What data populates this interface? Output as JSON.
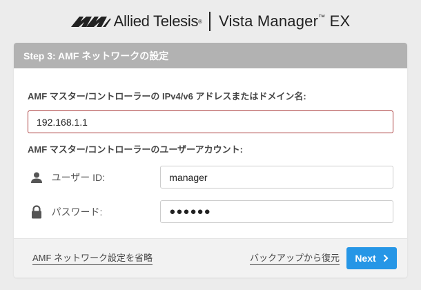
{
  "brand": {
    "company": "Allied Telesis",
    "registered_mark": "®",
    "product": "Vista Manager",
    "trademark": "™",
    "product_suffix": "EX"
  },
  "header": {
    "title": "Step 3: AMF ネットワークの設定"
  },
  "form": {
    "address_label": "AMF マスター/コントローラーの IPv4/v6 アドレスまたはドメイン名:",
    "address_value": "192.168.1.1",
    "account_label": "AMF マスター/コントローラーのユーザーアカウント:",
    "user_label": "ユーザー ID:",
    "user_value": "manager",
    "user_icon": "person-icon",
    "password_label": "パスワード:",
    "password_value": "●●●●●●",
    "password_icon": "lock-icon"
  },
  "footer": {
    "skip_label": "AMF ネットワーク設定を省略",
    "restore_label": "バックアップから復元",
    "next_label": "Next"
  },
  "colors": {
    "background": "#ececec",
    "header_bg": "#b2b2b2",
    "accent": "#2696e6",
    "error_border": "#a93a3a"
  }
}
